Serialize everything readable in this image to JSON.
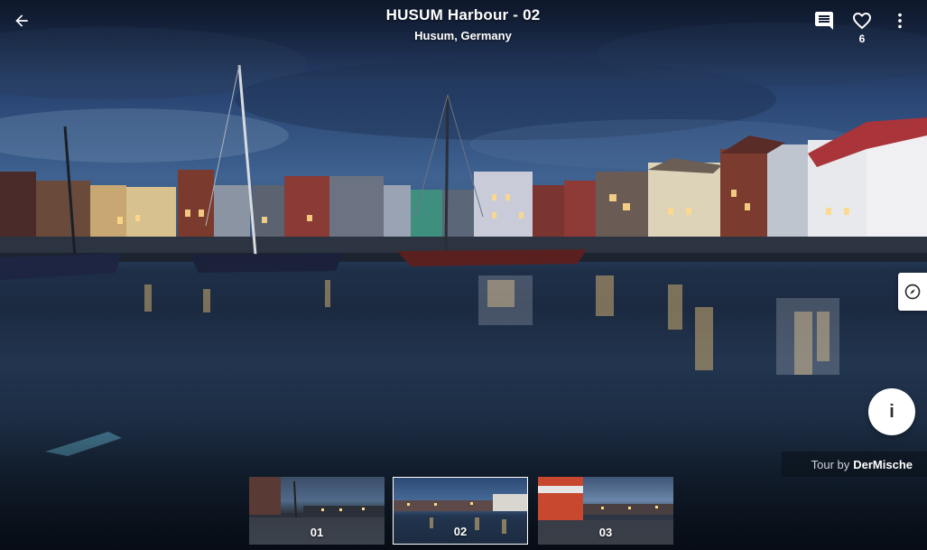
{
  "header": {
    "title": "HUSUM Harbour - 02",
    "subtitle": "Husum, Germany",
    "back_icon": "arrow-left-icon",
    "comment_icon": "comment-icon",
    "like_icon": "heart-outline-icon",
    "like_count": "6",
    "more_icon": "more-vertical-icon"
  },
  "side_controls": {
    "compass_icon": "compass-icon",
    "info_label": "i"
  },
  "credit": {
    "prefix": "Tour by",
    "author": "DerMische"
  },
  "thumbnails": [
    {
      "label": "01",
      "selected": false
    },
    {
      "label": "02",
      "selected": true
    },
    {
      "label": "03",
      "selected": false
    }
  ],
  "colors": {
    "overlay_icon": "#ffffff",
    "button_bg": "#ffffff",
    "info_text": "#2d2d33",
    "selected_border": "#ffffff"
  }
}
